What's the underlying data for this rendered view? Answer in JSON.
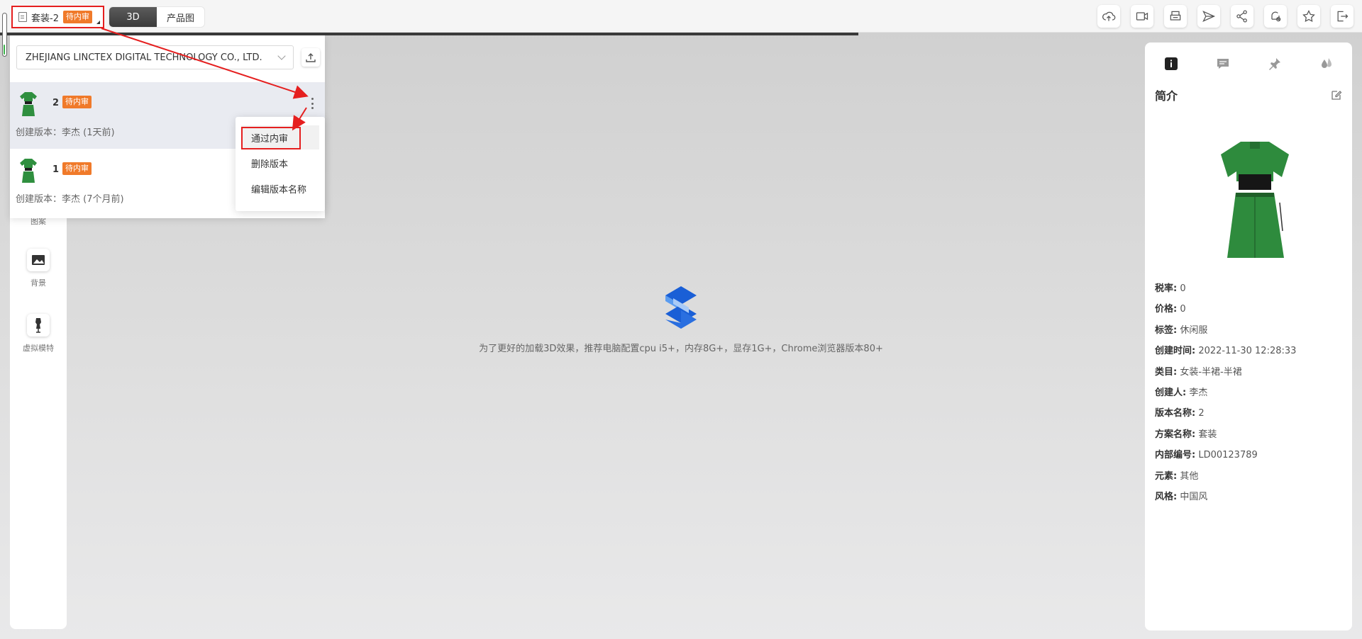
{
  "header": {
    "doc_title": "套装-2",
    "status_badge": "待内审",
    "view_tabs": [
      {
        "label": "3D",
        "active": true
      },
      {
        "label": "产品图",
        "active": false
      }
    ],
    "tools": [
      "cloud-upload-icon",
      "video-icon",
      "print-icon",
      "send-icon",
      "share-icon",
      "bell-off-icon",
      "star-icon",
      "exit-icon"
    ]
  },
  "left_rail": {
    "items": [
      {
        "label": "图案",
        "icon": "pattern-icon"
      },
      {
        "label": "背景",
        "icon": "background-icon"
      },
      {
        "label": "虚拟模特",
        "icon": "mannequin-icon"
      }
    ]
  },
  "version_panel": {
    "company": "ZHEJIANG LINCTEX DIGITAL TECHNOLOGY CO., LTD.",
    "versions": [
      {
        "number": "2",
        "badge": "待内审",
        "meta": "创建版本：李杰 (1天前)",
        "selected": true
      },
      {
        "number": "1",
        "badge": "待内审",
        "meta": "创建版本：李杰 (7个月前)",
        "selected": false
      }
    ],
    "context_menu": [
      "通过内审",
      "删除版本",
      "编辑版本名称"
    ]
  },
  "center": {
    "message": "为了更好的加载3D效果，推荐电脑配置cpu i5+，内存8G+，显存1G+，Chrome浏览器版本80+"
  },
  "info_panel": {
    "title": "简介",
    "tabs": [
      "info-icon",
      "comment-icon",
      "pin-icon",
      "drops-icon"
    ],
    "fields": [
      {
        "key": "税率:",
        "value": "0"
      },
      {
        "key": "价格:",
        "value": "0"
      },
      {
        "key": "标签:",
        "value": "休闲服"
      },
      {
        "key": "创建时间:",
        "value": "2022-11-30 12:28:33"
      },
      {
        "key": "类目:",
        "value": "女装-半裙-半裙"
      },
      {
        "key": "创建人:",
        "value": "李杰"
      },
      {
        "key": "版本名称:",
        "value": "2"
      },
      {
        "key": "方案名称:",
        "value": "套装"
      },
      {
        "key": "内部编号:",
        "value": "LD00123789"
      },
      {
        "key": "元素:",
        "value": "其他"
      },
      {
        "key": "风格:",
        "value": "中国风"
      }
    ]
  },
  "colors": {
    "accent_orange": "#f07a2a",
    "highlight_red": "#e51f1f",
    "garment_green": "#2f8f3f"
  }
}
